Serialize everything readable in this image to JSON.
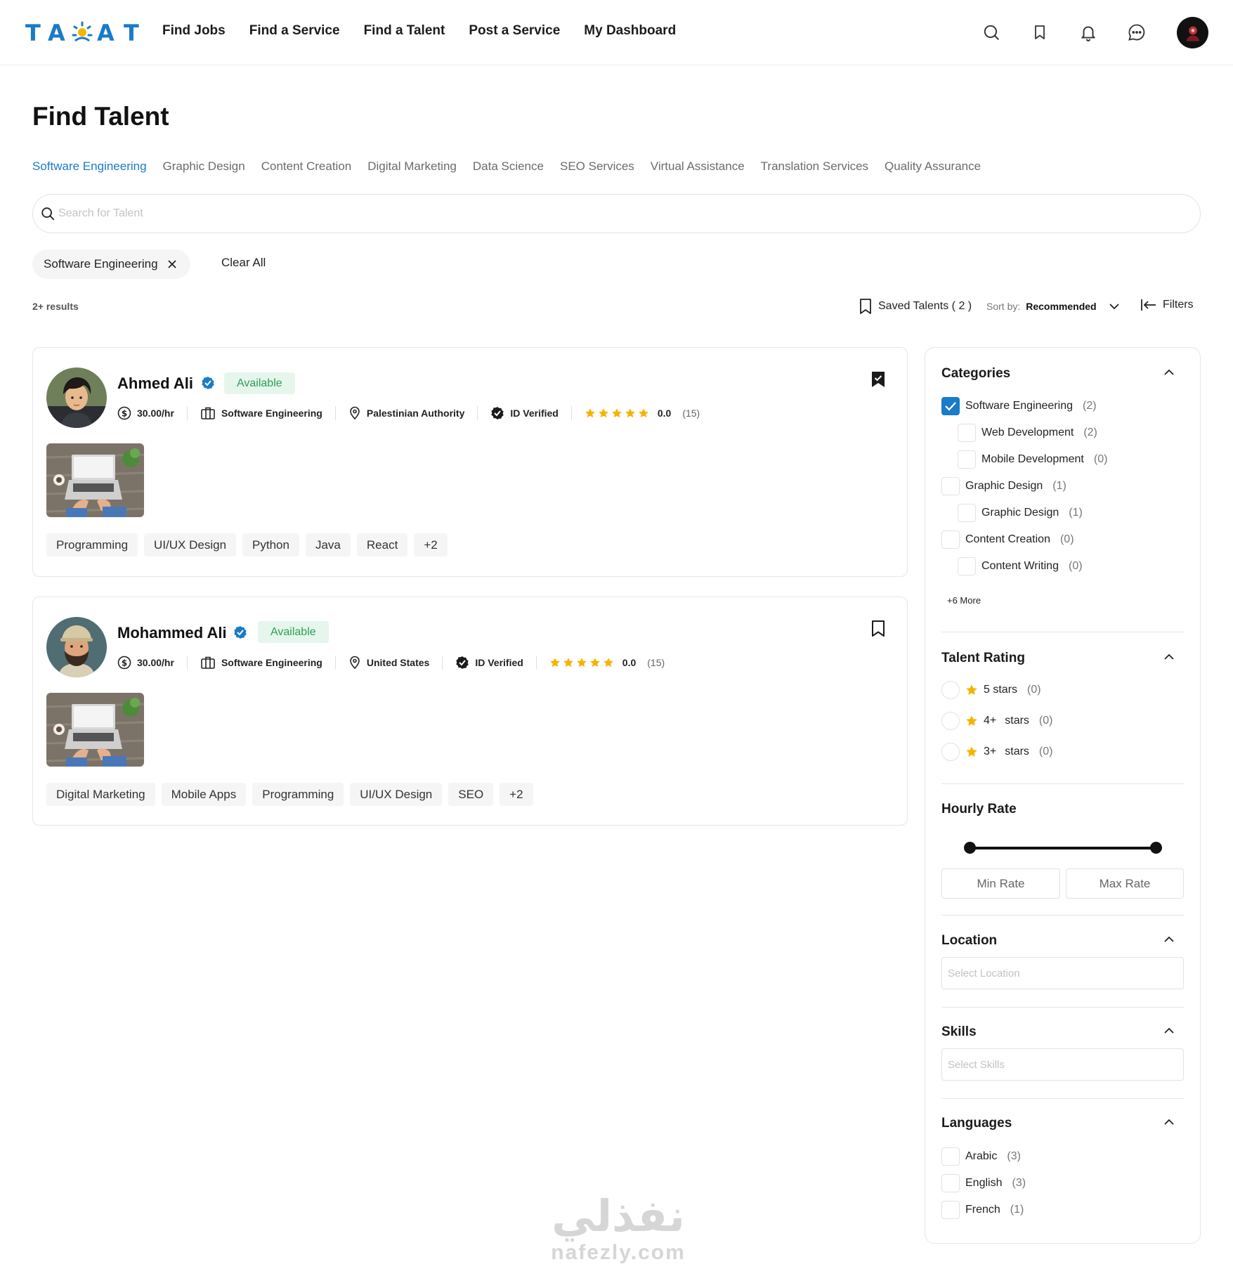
{
  "brand": {
    "logo_text": "TAQAT",
    "accent": "#1a7bc7",
    "sun": "#f5b400"
  },
  "nav": {
    "items": [
      "Find Jobs",
      "Find a Service",
      "Find a Talent",
      "Post a Service",
      "My Dashboard"
    ]
  },
  "header_icons": [
    "search-icon",
    "bookmark-icon",
    "bell-icon",
    "chat-icon",
    "user-avatar"
  ],
  "page": {
    "title": "Find Talent"
  },
  "tabs": [
    "Software Engineering",
    "Graphic Design",
    "Content Creation",
    "Digital Marketing",
    "Data Science",
    "SEO Services",
    "Virtual Assistance",
    "Translation Services",
    "Quality Assurance"
  ],
  "active_tab": "Software Engineering",
  "search": {
    "placeholder": "Search for Talent"
  },
  "active_filter": {
    "label": "Software Engineering"
  },
  "clear_all": "Clear All",
  "results": "2+ results",
  "saved_talents": "Saved Talents ( 2 )",
  "sort": {
    "label": "Sort by:",
    "value": "Recommended"
  },
  "filters_label": "Filters",
  "talents": [
    {
      "name": "Ahmed Ali",
      "status": "Available",
      "rate": "30.00/hr",
      "category": "Software Engineering",
      "location": "Palestinian Authority",
      "verified": "ID Verified",
      "stars": 5,
      "rating": "0.0",
      "reviews": "(15)",
      "saved": true,
      "skills": [
        "Programming",
        "UI/UX Design",
        "Python",
        "Java",
        "React",
        "+2"
      ]
    },
    {
      "name": "Mohammed Ali",
      "status": "Available",
      "rate": "30.00/hr",
      "category": "Software Engineering",
      "location": "United States",
      "verified": "ID Verified",
      "stars": 5,
      "rating": "0.0",
      "reviews": "(15)",
      "saved": false,
      "skills": [
        "Digital Marketing",
        "Mobile Apps",
        "Programming",
        "UI/UX Design",
        "SEO",
        "+2"
      ]
    }
  ],
  "sidebar": {
    "categories": {
      "title": "Categories",
      "items": [
        {
          "label": "Software Engineering",
          "count": "(2)",
          "checked": true
        },
        {
          "label": "Web Development",
          "count": "(2)",
          "checked": false
        },
        {
          "label": "Mobile Development",
          "count": "(0)",
          "checked": false
        },
        {
          "label": "Graphic Design",
          "count": "(1)",
          "checked": false
        },
        {
          "label": "Graphic Design",
          "count": "(1)",
          "checked": false
        },
        {
          "label": "Content Creation",
          "count": "(0)",
          "checked": false
        },
        {
          "label": "Content Writing",
          "count": "(0)",
          "checked": false
        }
      ],
      "more": "+6 More"
    },
    "rating": {
      "title": "Talent Rating",
      "items": [
        {
          "value": "5 stars",
          "count": "(0)"
        },
        {
          "value": "4+",
          "unit": "stars",
          "count": "(0)"
        },
        {
          "value": "3+",
          "unit": "stars",
          "count": "(0)"
        }
      ]
    },
    "hourly": {
      "title": "Hourly Rate",
      "min_label": "Min Rate",
      "max_label": "Max Rate"
    },
    "location": {
      "title": "Location",
      "placeholder": "Select Location"
    },
    "skills": {
      "title": "Skills",
      "placeholder": "Select Skills"
    },
    "languages": {
      "title": "Languages",
      "items": [
        {
          "label": "Arabic",
          "count": "(3)"
        },
        {
          "label": "English",
          "count": "(3)"
        },
        {
          "label": "French",
          "count": "(1)"
        }
      ]
    }
  },
  "watermark": {
    "arabic": "نفذلي",
    "latin": "nafezly.com"
  }
}
